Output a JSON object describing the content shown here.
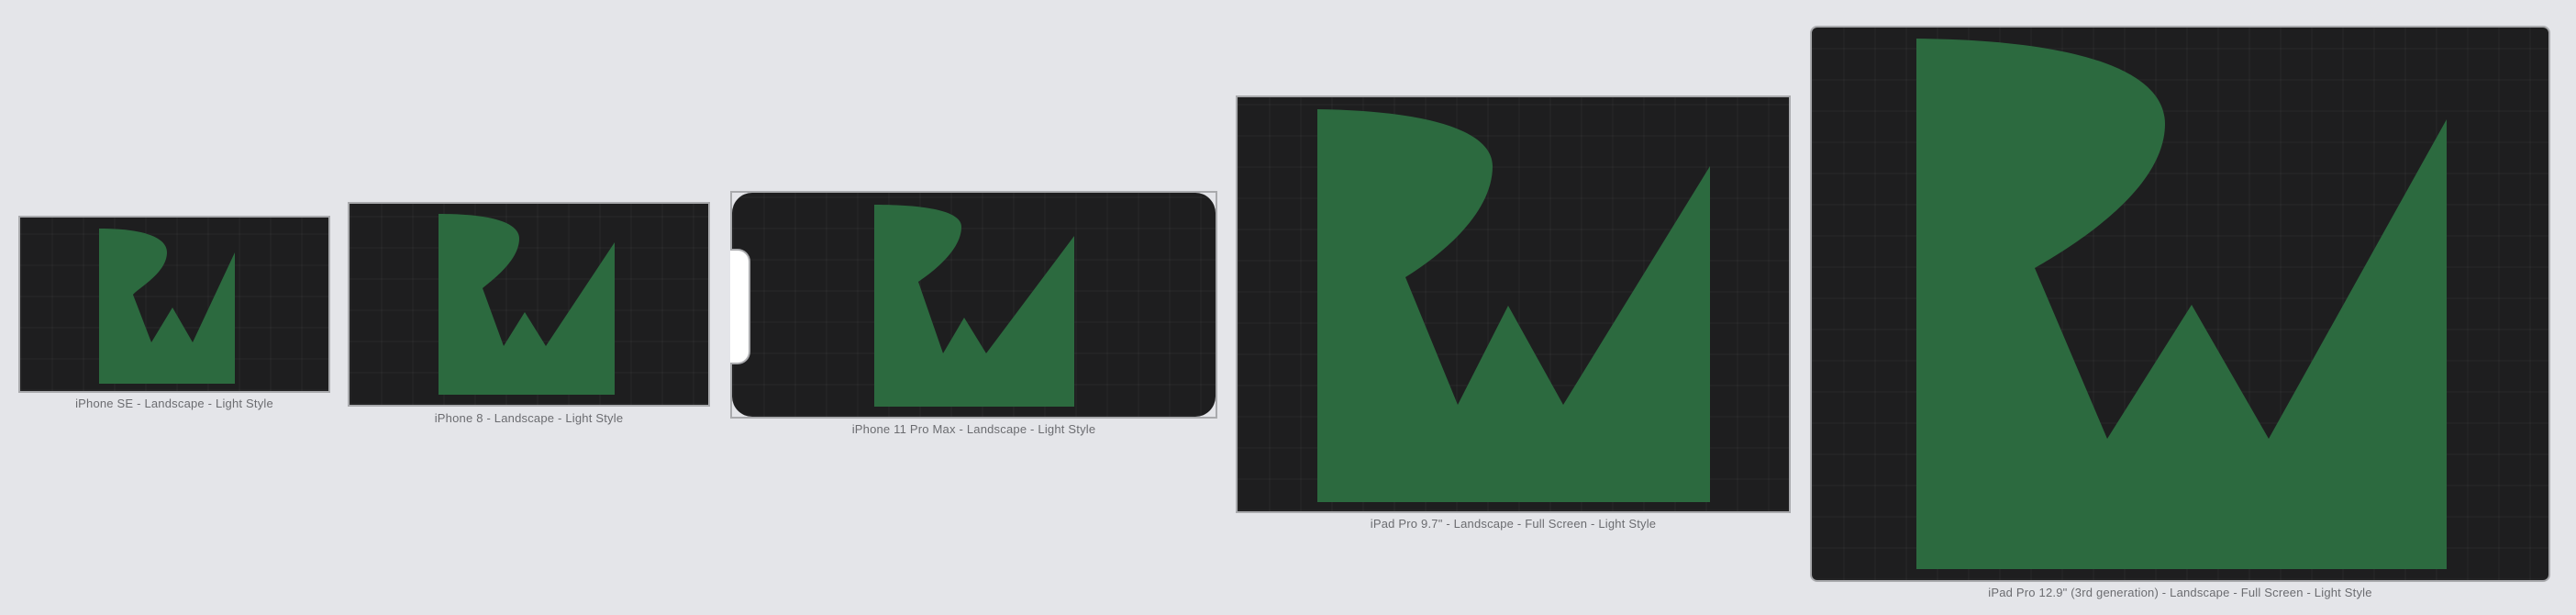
{
  "canvas": {
    "background": "#e4e5e9"
  },
  "logo": {
    "color": "#2c6a3f",
    "screen_color": "#1e1e1f",
    "icon": "rw-logo-icon"
  },
  "previews": [
    {
      "id": "iphone-se",
      "caption": "iPhone SE - Landscape - Light Style"
    },
    {
      "id": "iphone-8",
      "caption": "iPhone 8 - Landscape - Light Style"
    },
    {
      "id": "iphone-11-pro-max",
      "caption": "iPhone 11 Pro Max - Landscape - Light Style"
    },
    {
      "id": "ipad-pro-97",
      "caption": "iPad Pro 9.7\" - Landscape - Full Screen - Light Style"
    },
    {
      "id": "ipad-pro-129",
      "caption": "iPad Pro 12.9\" (3rd generation) - Landscape - Full Screen - Light Style"
    }
  ]
}
